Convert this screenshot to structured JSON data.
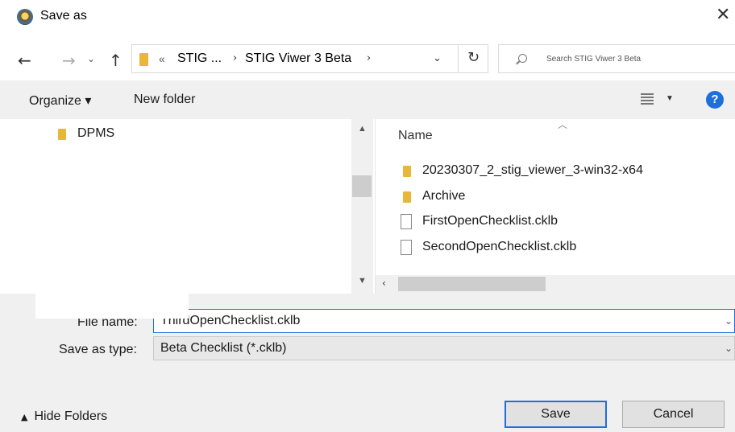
{
  "window": {
    "title": "Save as"
  },
  "address": {
    "overflow_glyph": "«",
    "crumbs": [
      "STIG ...",
      "STIG Viwer 3 Beta"
    ]
  },
  "search": {
    "placeholder": "Search STIG Viwer 3 Beta"
  },
  "toolbar": {
    "organize_label": "Organize ▾",
    "new_folder_label": "New folder",
    "help_label": "?"
  },
  "tree": {
    "items": [
      {
        "label": "DPMS",
        "icon": "folder-icon"
      }
    ]
  },
  "files": {
    "column_name": "Name",
    "items": [
      {
        "label": "20230307_2_stig_viewer_3-win32-x64",
        "icon": "folder-icon"
      },
      {
        "label": "Archive",
        "icon": "folder-icon"
      },
      {
        "label": "FirstOpenChecklist.cklb",
        "icon": "file-icon"
      },
      {
        "label": "SecondOpenChecklist.cklb",
        "icon": "file-icon"
      }
    ]
  },
  "form": {
    "file_name_label": "File name:",
    "file_name_value": "ThirdOpenChecklist.cklb",
    "save_type_label": "Save as type:",
    "save_type_value": "Beta Checklist (*.cklb)"
  },
  "footer": {
    "hide_folders_label": "Hide Folders",
    "save_label": "Save",
    "cancel_label": "Cancel"
  },
  "colors": {
    "accent": "#1e6fd9",
    "folder": "#e8b73a",
    "toolbar_bg": "#f0f0f0"
  }
}
